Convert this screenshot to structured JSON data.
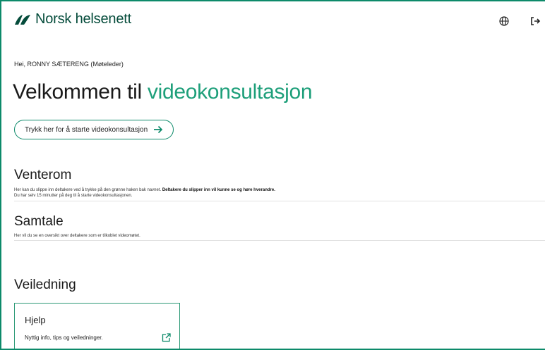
{
  "header": {
    "brand": "Norsk helsenett",
    "icons": [
      "globe-icon",
      "logout-icon"
    ],
    "accent_color": "#0d8a6a"
  },
  "greeting": "Hei, RONNY SÆTERENG (Møteleder)",
  "welcome": {
    "title_plain": "Velkommen til",
    "title_accent": "videokonsultasjon"
  },
  "start_button": {
    "label": "Trykk her for å starte videokonsultasjon"
  },
  "waiting_room": {
    "title": "Venterom",
    "desc_plain": "Her kan du slippe inn deltakere ved å trykke på den grønne haken bak navnet.",
    "desc_bold": "Deltakere du slipper inn vil kunne se og høre hverandre.",
    "desc_line2": "Du har selv 15 minutter på deg til å starte videokonsultasjonen."
  },
  "conversation": {
    "title": "Samtale",
    "desc": "Her vil du se en oversikt over deltakere som er tilkoblet videomøtet."
  },
  "guidance": {
    "title": "Veiledning",
    "card": {
      "title": "Hjelp",
      "desc": "Nyttig info, tips og veiledninger."
    }
  }
}
